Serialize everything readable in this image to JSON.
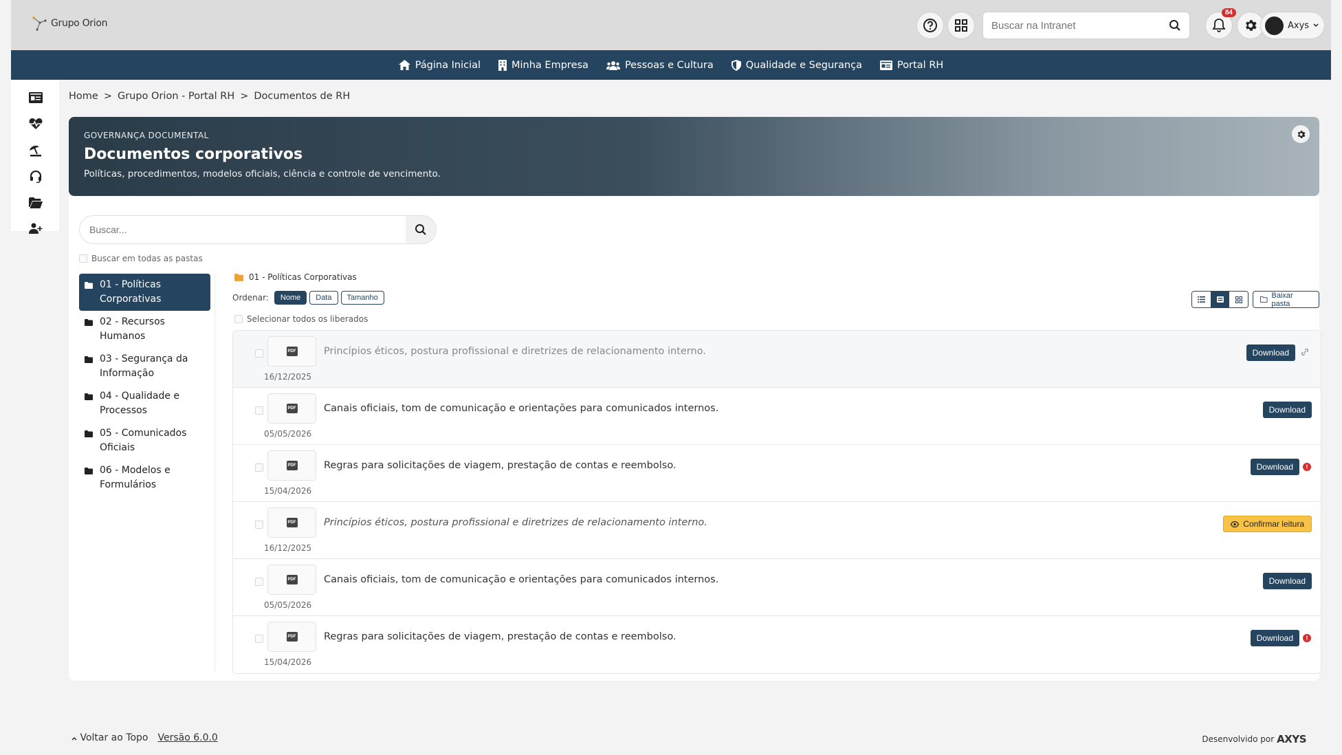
{
  "header": {
    "logo_text": "Grupo Orion",
    "search_placeholder": "Buscar na Intranet",
    "notification_count": "84",
    "user_name": "Axys"
  },
  "nav": {
    "items": [
      {
        "label": "Página Inicial",
        "icon": "home-icon"
      },
      {
        "label": "Minha Empresa",
        "icon": "building-icon"
      },
      {
        "label": "Pessoas e Cultura",
        "icon": "users-icon"
      },
      {
        "label": "Qualidade e Segurança",
        "icon": "shield-icon"
      },
      {
        "label": "Portal RH",
        "icon": "id-card-icon"
      }
    ]
  },
  "rail": {
    "icons": [
      "id-card-icon",
      "heart-pulse-icon",
      "umbrella-beach-icon",
      "headset-icon",
      "folder-open-icon",
      "user-plus-icon"
    ]
  },
  "breadcrumb": {
    "items": [
      "Home",
      "Grupo Orion - Portal RH",
      "Documentos de RH"
    ],
    "separator": ">"
  },
  "banner": {
    "eyebrow": "GOVERNANÇA DOCUMENTAL",
    "title": "Documentos corporativos",
    "subtitle": "Políticas, procedimentos, modelos oficiais, ciência e controle de vencimento."
  },
  "search": {
    "placeholder": "Buscar...",
    "all_folders_label": "Buscar em todas as pastas"
  },
  "folders": [
    {
      "label": "01 - Políticas Corporativas",
      "active": true
    },
    {
      "label": "02 - Recursos Humanos",
      "active": false
    },
    {
      "label": "03 - Segurança da Informação",
      "active": false
    },
    {
      "label": "04 - Qualidade e Processos",
      "active": false
    },
    {
      "label": "05 - Comunicados Oficiais",
      "active": false
    },
    {
      "label": "06 - Modelos e Formulários",
      "active": false
    }
  ],
  "documents_panel": {
    "current_folder": "01 - Políticas Corporativas",
    "sort_label": "Ordenar:",
    "sort_options": [
      "Nome",
      "Data",
      "Tamanho"
    ],
    "sort_selected": "Nome",
    "select_all_label": "Selecionar todos os liberados",
    "download_folder_label": "Baixar pasta",
    "view_selected": "compact-list"
  },
  "documents": [
    {
      "title": "Princípios éticos, postura profissional e diretrizes de relacionamento interno.",
      "date": "16/12/2025",
      "type": "PDF",
      "action": "Download",
      "extra": "link",
      "style": "muted"
    },
    {
      "title": "Canais oficiais, tom de comunicação e orientações para comunicados internos.",
      "date": "05/05/2026",
      "type": "PDF",
      "action": "Download",
      "extra": "",
      "style": "normal"
    },
    {
      "title": "Regras para solicitações de viagem, prestação de contas e reembolso.",
      "date": "15/04/2026",
      "type": "PDF",
      "action": "Download",
      "extra": "alert",
      "style": "normal"
    },
    {
      "title": "Princípios éticos, postura profissional e diretrizes de relacionamento interno.",
      "date": "16/12/2025",
      "type": "PDF",
      "action": "Confirmar leitura",
      "extra": "",
      "style": "italic"
    },
    {
      "title": "Canais oficiais, tom de comunicação e orientações para comunicados internos.",
      "date": "05/05/2026",
      "type": "PDF",
      "action": "Download",
      "extra": "",
      "style": "normal"
    },
    {
      "title": "Regras para solicitações de viagem, prestação de contas e reembolso.",
      "date": "15/04/2026",
      "type": "PDF",
      "action": "Download",
      "extra": "alert",
      "style": "normal"
    }
  ],
  "footer": {
    "back_to_top": "Voltar ao Topo",
    "version": "Versão 6.0.0",
    "developed_by": "Desenvolvido por",
    "brand": "AXYS"
  },
  "colors": {
    "primary": "#24445f",
    "warning": "#f7c246",
    "danger": "#d32f2f"
  }
}
